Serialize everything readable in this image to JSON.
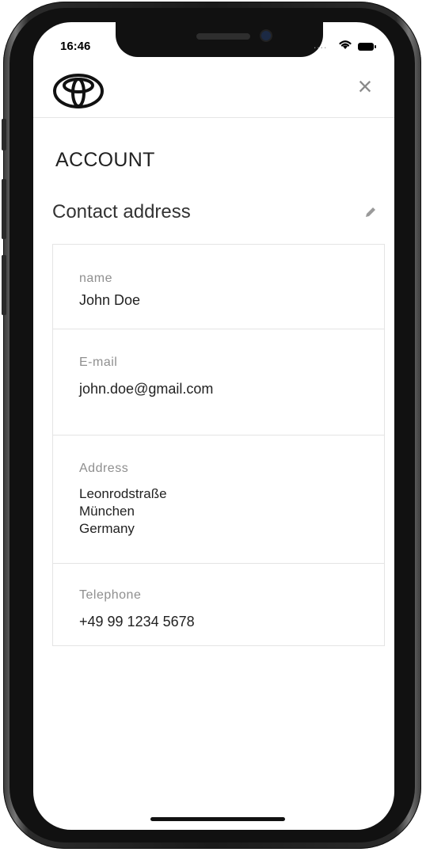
{
  "status_bar": {
    "time": "16:46",
    "signal_dots": "....",
    "wifi_icon": "wifi-icon",
    "battery_icon": "battery-icon"
  },
  "header": {
    "logo_icon": "toyota-logo-icon",
    "close_label": "×"
  },
  "page": {
    "title": "ACCOUNT"
  },
  "section": {
    "title": "Contact address",
    "edit_icon": "pencil-icon"
  },
  "fields": {
    "name": {
      "label": "name",
      "value": "John Doe"
    },
    "email": {
      "label": "E-mail",
      "value": "john.doe@gmail.com"
    },
    "address": {
      "label": "Address",
      "lines": [
        "Leonrodstraße",
        "München",
        "Germany"
      ]
    },
    "telephone": {
      "label": "Telephone",
      "value": "+49 99 1234 5678"
    }
  },
  "colors": {
    "text_primary": "#222222",
    "text_label": "#8f8f8f",
    "divider": "#e4e4e4",
    "close_icon": "#8a8a8a"
  }
}
